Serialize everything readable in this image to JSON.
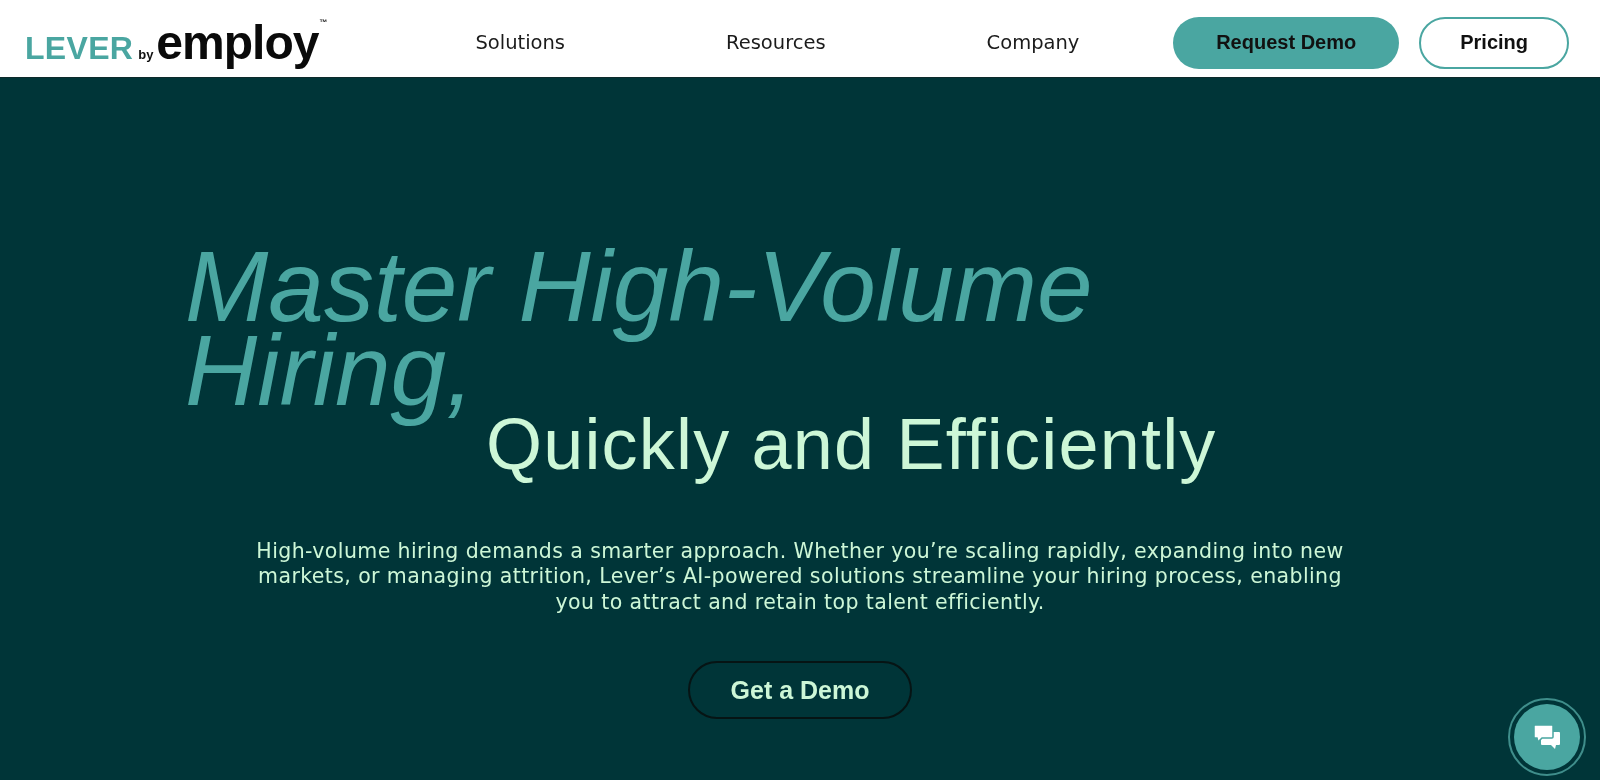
{
  "nav": {
    "logo": {
      "brand": "LEVER",
      "by": "by",
      "name": "employ",
      "mark": "™"
    },
    "links": [
      "Solutions",
      "Resources",
      "Company"
    ],
    "buttons": [
      {
        "label": "Request Demo",
        "kind": "filled"
      },
      {
        "label": "Pricing",
        "kind": "outline"
      }
    ]
  },
  "hero": {
    "title_script": "Master High-Volume Hiring,",
    "title_plain": "Quickly and Efficiently",
    "description": "High-volume hiring demands a smarter approach. Whether you’re scaling rapidly, expanding into new markets, or managing attrition, Lever’s AI-powered solutions streamline your hiring process, enabling you to attract and retain top talent efficiently.",
    "cta": "Get a Demo"
  }
}
